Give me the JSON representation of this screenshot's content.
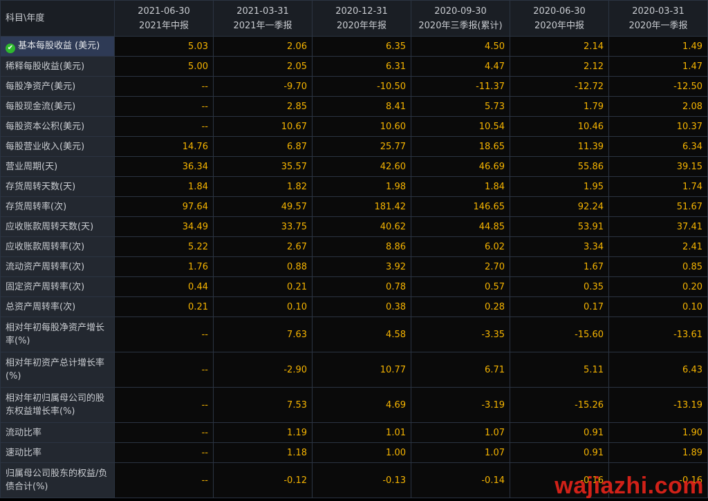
{
  "header": {
    "corner": "科目\\年度",
    "columns": [
      {
        "date": "2021-06-30",
        "period": "2021年中报"
      },
      {
        "date": "2021-03-31",
        "period": "2021年一季报"
      },
      {
        "date": "2020-12-31",
        "period": "2020年年报"
      },
      {
        "date": "2020-09-30",
        "period": "2020年三季报(累计)"
      },
      {
        "date": "2020-06-30",
        "period": "2020年中报"
      },
      {
        "date": "2020-03-31",
        "period": "2020年一季报"
      }
    ]
  },
  "rows": [
    {
      "label": "基本每股收益 (美元)",
      "values": [
        "5.03",
        "2.06",
        "6.35",
        "4.50",
        "2.14",
        "1.49"
      ],
      "selected": true,
      "icon": "check-circle-icon"
    },
    {
      "label": "稀释每股收益(美元)",
      "values": [
        "5.00",
        "2.05",
        "6.31",
        "4.47",
        "2.12",
        "1.47"
      ]
    },
    {
      "label": "每股净资产(美元)",
      "values": [
        "--",
        "-9.70",
        "-10.50",
        "-11.37",
        "-12.72",
        "-12.50"
      ]
    },
    {
      "label": "每股现金流(美元)",
      "values": [
        "--",
        "2.85",
        "8.41",
        "5.73",
        "1.79",
        "2.08"
      ]
    },
    {
      "label": "每股资本公积(美元)",
      "values": [
        "--",
        "10.67",
        "10.60",
        "10.54",
        "10.46",
        "10.37"
      ]
    },
    {
      "label": "每股营业收入(美元)",
      "values": [
        "14.76",
        "6.87",
        "25.77",
        "18.65",
        "11.39",
        "6.34"
      ]
    },
    {
      "label": "营业周期(天)",
      "values": [
        "36.34",
        "35.57",
        "42.60",
        "46.69",
        "55.86",
        "39.15"
      ]
    },
    {
      "label": "存货周转天数(天)",
      "values": [
        "1.84",
        "1.82",
        "1.98",
        "1.84",
        "1.95",
        "1.74"
      ]
    },
    {
      "label": "存货周转率(次)",
      "values": [
        "97.64",
        "49.57",
        "181.42",
        "146.65",
        "92.24",
        "51.67"
      ]
    },
    {
      "label": "应收账款周转天数(天)",
      "values": [
        "34.49",
        "33.75",
        "40.62",
        "44.85",
        "53.91",
        "37.41"
      ]
    },
    {
      "label": "应收账款周转率(次)",
      "values": [
        "5.22",
        "2.67",
        "8.86",
        "6.02",
        "3.34",
        "2.41"
      ]
    },
    {
      "label": "流动资产周转率(次)",
      "values": [
        "1.76",
        "0.88",
        "3.92",
        "2.70",
        "1.67",
        "0.85"
      ]
    },
    {
      "label": "固定资产周转率(次)",
      "values": [
        "0.44",
        "0.21",
        "0.78",
        "0.57",
        "0.35",
        "0.20"
      ]
    },
    {
      "label": "总资产周转率(次)",
      "values": [
        "0.21",
        "0.10",
        "0.38",
        "0.28",
        "0.17",
        "0.10"
      ]
    },
    {
      "label": "相对年初每股净资产增长率(%)",
      "values": [
        "--",
        "7.63",
        "4.58",
        "-3.35",
        "-15.60",
        "-13.61"
      ],
      "tall": true
    },
    {
      "label": "相对年初资产总计增长率(%)",
      "values": [
        "--",
        "-2.90",
        "10.77",
        "6.71",
        "5.11",
        "6.43"
      ],
      "tall": true
    },
    {
      "label": "相对年初归属母公司的股东权益增长率(%)",
      "values": [
        "--",
        "7.53",
        "4.69",
        "-3.19",
        "-15.26",
        "-13.19"
      ],
      "tall": true
    },
    {
      "label": "流动比率",
      "values": [
        "--",
        "1.19",
        "1.01",
        "1.07",
        "0.91",
        "1.90"
      ]
    },
    {
      "label": "速动比率",
      "values": [
        "--",
        "1.18",
        "1.00",
        "1.07",
        "0.91",
        "1.89"
      ]
    },
    {
      "label": "归属母公司股东的权益/负债合计(%)",
      "values": [
        "--",
        "-0.12",
        "-0.13",
        "-0.14",
        "-0.16",
        "-0.16"
      ],
      "tall": true
    }
  ],
  "watermark": "wajiazhi.com",
  "colors": {
    "value": "#f7b500",
    "label_bg": "#232830",
    "highlight_bg": "#2e3a55",
    "check": "#2eb82e"
  }
}
